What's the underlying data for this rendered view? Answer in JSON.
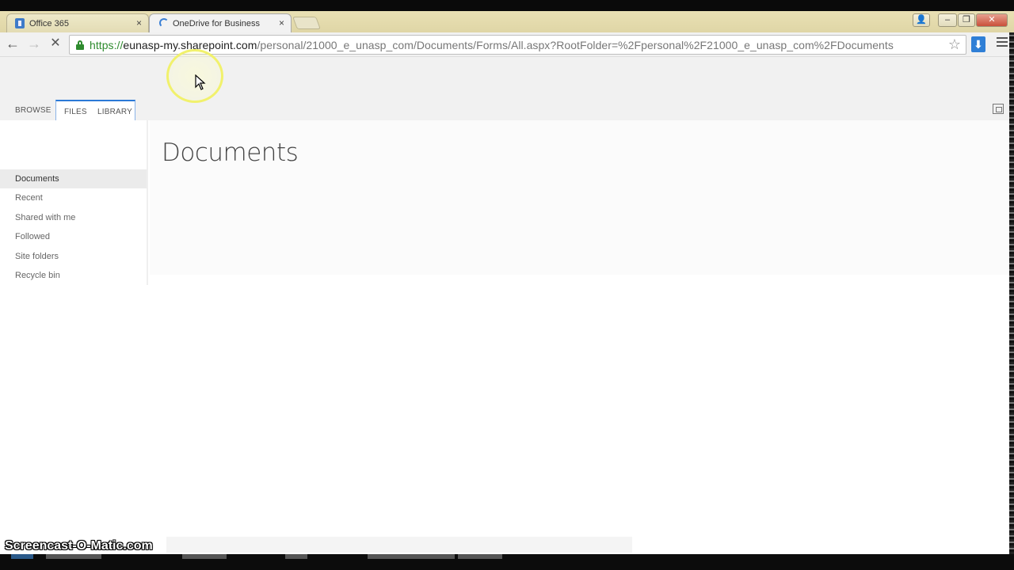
{
  "browser": {
    "tabs": [
      {
        "title": "Office 365",
        "active": false,
        "icon": "office-icon"
      },
      {
        "title": "OneDrive for Business",
        "active": true,
        "icon": "loading-spinner-icon"
      }
    ],
    "tab_close": "×",
    "window_controls": {
      "minimize": "–",
      "restore": "❐",
      "close": "✕",
      "user": "👤"
    },
    "url": {
      "proto": "https://",
      "host": "eunasp-my.sharepoint.com",
      "path": "/personal/21000_e_unasp_com/Documents/Forms/All.aspx?RootFolder=%2Fpersonal%2F21000_e_unasp_com%2FDocuments"
    },
    "nav": {
      "back": "←",
      "forward": "→",
      "stop": "✕"
    },
    "star": "☆",
    "download": "⬇"
  },
  "ribbon": {
    "tabs": [
      {
        "label": "BROWSE",
        "selected": false
      },
      {
        "label": "FILES",
        "selected": true
      },
      {
        "label": "LIBRARY",
        "selected": false
      }
    ]
  },
  "left_nav": {
    "items": [
      {
        "label": "Documents",
        "selected": true
      },
      {
        "label": "Recent",
        "selected": false
      },
      {
        "label": "Shared with me",
        "selected": false
      },
      {
        "label": "Followed",
        "selected": false
      },
      {
        "label": "Site folders",
        "selected": false
      },
      {
        "label": "Recycle bin",
        "selected": false
      }
    ]
  },
  "main": {
    "title": "Documents"
  },
  "watermark": "Screencast-O-Matic.com",
  "colors": {
    "accent": "#2b79d6",
    "tabbar": "#e6ddb0",
    "secure": "#2e8b2e"
  }
}
